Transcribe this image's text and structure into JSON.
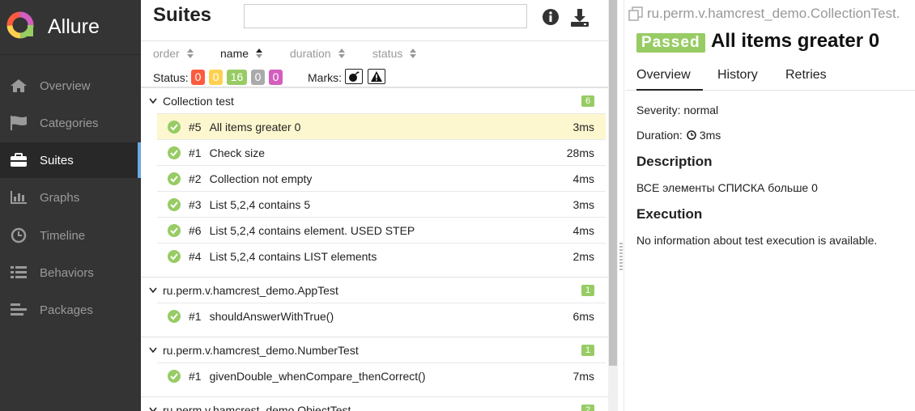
{
  "app": {
    "title": "Allure"
  },
  "sidebar": {
    "items": [
      {
        "label": "Overview"
      },
      {
        "label": "Categories"
      },
      {
        "label": "Suites"
      },
      {
        "label": "Graphs"
      },
      {
        "label": "Timeline"
      },
      {
        "label": "Behaviors"
      },
      {
        "label": "Packages"
      }
    ],
    "active": "Suites"
  },
  "suites": {
    "title": "Suites",
    "search": {
      "value": "",
      "placeholder": ""
    },
    "sort": {
      "order": "order",
      "name": "name",
      "duration": "duration",
      "status": "status"
    },
    "status_label": "Status:",
    "status_counts": [
      {
        "value": "0",
        "color": "#fd5a3e"
      },
      {
        "value": "0",
        "color": "#ffd050"
      },
      {
        "value": "16",
        "color": "#97cc64"
      },
      {
        "value": "0",
        "color": "#aaaaaa"
      },
      {
        "value": "0",
        "color": "#d35ebe"
      }
    ],
    "marks_label": "Marks:",
    "groups": [
      {
        "name": "Collection test",
        "count": "6",
        "tests": [
          {
            "num": "#5",
            "name": "All items greater 0",
            "duration": "3ms",
            "selected": true
          },
          {
            "num": "#1",
            "name": "Check size",
            "duration": "28ms"
          },
          {
            "num": "#2",
            "name": "Collection not empty",
            "duration": "4ms"
          },
          {
            "num": "#3",
            "name": "List 5,2,4 contains 5",
            "duration": "3ms"
          },
          {
            "num": "#6",
            "name": "List 5,2,4 contains element. USED STEP",
            "duration": "4ms"
          },
          {
            "num": "#4",
            "name": "List 5,2,4 contains LIST elements",
            "duration": "2ms"
          }
        ]
      },
      {
        "name": "ru.perm.v.hamcrest_demo.AppTest",
        "count": "1",
        "tests": [
          {
            "num": "#1",
            "name": "shouldAnswerWithTrue()",
            "duration": "6ms"
          }
        ]
      },
      {
        "name": "ru.perm.v.hamcrest_demo.NumberTest",
        "count": "1",
        "tests": [
          {
            "num": "#1",
            "name": "givenDouble_whenCompare_thenCorrect()",
            "duration": "7ms"
          }
        ]
      },
      {
        "name": "ru.perm.v.hamcrest_demo.ObjectTest",
        "count": "2",
        "tests": []
      }
    ]
  },
  "details": {
    "breadcrumb": "ru.perm.v.hamcrest_demo.CollectionTest.",
    "status": "Passed",
    "title": "All items greater 0",
    "tabs": [
      {
        "label": "Overview"
      },
      {
        "label": "History"
      },
      {
        "label": "Retries"
      }
    ],
    "severity": "Severity: normal",
    "duration_label": "Duration:",
    "duration_value": "3ms",
    "description_heading": "Description",
    "description_text": "ВСЕ элементы СПИСКА больше 0",
    "execution_heading": "Execution",
    "execution_text": "No information about test execution is available."
  },
  "colors": {
    "passed": "#97cc64",
    "sidebar": "#343434",
    "selected_row": "#fdf7cf"
  }
}
